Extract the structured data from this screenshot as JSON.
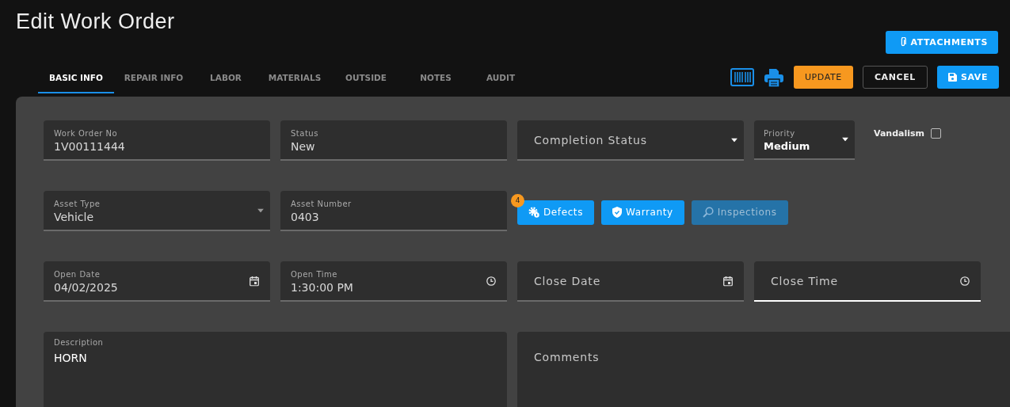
{
  "title": "Edit Work Order",
  "attachments_button": "ATTACHMENTS",
  "tabs": [
    {
      "label": "BASIC INFO",
      "selected": true
    },
    {
      "label": "REPAIR INFO",
      "selected": false
    },
    {
      "label": "LABOR",
      "selected": false
    },
    {
      "label": "MATERIALS",
      "selected": false
    },
    {
      "label": "OUTSIDE",
      "selected": false
    },
    {
      "label": "NOTES",
      "selected": false
    },
    {
      "label": "AUDIT",
      "selected": false
    }
  ],
  "toolbar": {
    "update": "UPDATE",
    "cancel": "CANCEL",
    "save": "SAVE"
  },
  "fields": [
    {
      "kind": "text",
      "label": "Work Order No",
      "value": "1V00111444",
      "focused": false
    },
    {
      "kind": "text",
      "label": "Status",
      "value": "New",
      "focused": false
    },
    {
      "kind": "select",
      "placeholder": "Completion Status",
      "focused": false
    },
    {
      "kind": "priority",
      "label": "Priority",
      "value": "Medium",
      "checkbox": {
        "label": "Vandalism",
        "checked": false
      }
    },
    {
      "kind": "select",
      "label": "Asset Type",
      "value": "Vehicle",
      "focused": false
    },
    {
      "kind": "text",
      "label": "Asset Number",
      "value": "0403",
      "focused": false
    },
    {
      "kind": "buttons",
      "buttons": [
        {
          "label": "Defects",
          "badge": "4",
          "disabled": false
        },
        {
          "label": "Warranty",
          "disabled": false
        },
        {
          "label": "Inspections",
          "disabled": true
        }
      ]
    },
    {
      "kind": "date",
      "label": "Open Date",
      "value": "04/02/2025",
      "focused": false
    },
    {
      "kind": "time",
      "label": "Open Time",
      "value": "1:30:00 PM",
      "focused": false
    },
    {
      "kind": "date",
      "placeholder": "Close Date",
      "focused": false
    },
    {
      "kind": "time",
      "placeholder": "Close Time",
      "focused": true
    },
    {
      "kind": "textarea",
      "label": "Description",
      "value": "HORN"
    },
    {
      "kind": "textarea",
      "placeholder": "Comments"
    }
  ]
}
